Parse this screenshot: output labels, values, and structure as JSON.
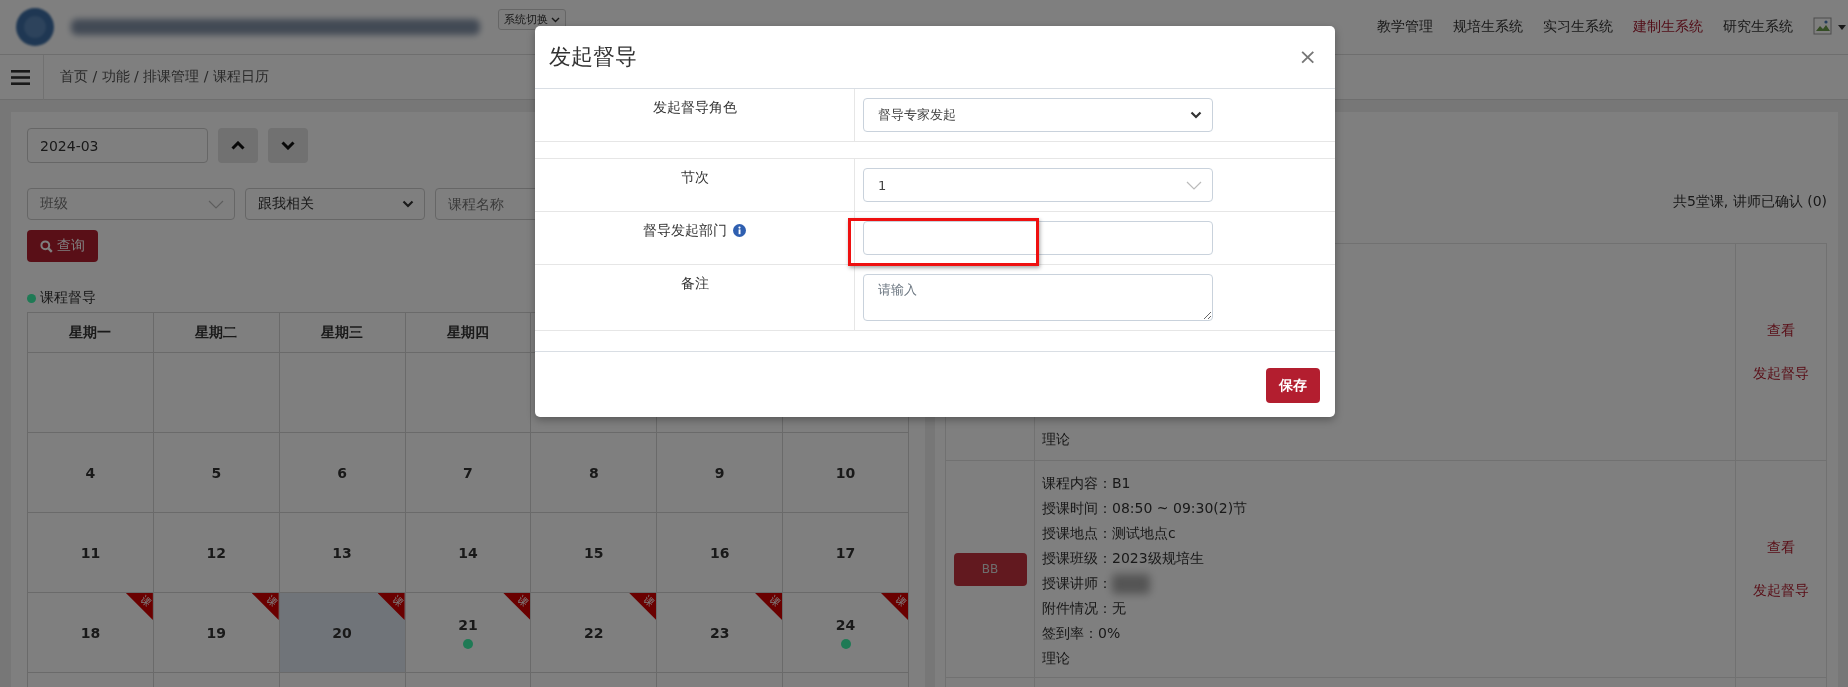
{
  "topbar": {
    "switch_label": "系统切换",
    "nav": [
      {
        "label": "教学管理",
        "selected": false
      },
      {
        "label": "规培生系统",
        "selected": false
      },
      {
        "label": "实习生系统",
        "selected": false
      },
      {
        "label": "建制生系统",
        "selected": true
      },
      {
        "label": "研究生系统",
        "selected": false
      }
    ]
  },
  "breadcrumb": "首页 / 功能 / 排课管理 / 课程日历",
  "filters": {
    "month": "2024-03",
    "class_placeholder": "班级",
    "relation": "跟我相关",
    "course_placeholder": "课程名称",
    "query_button": "查询"
  },
  "legend": {
    "label": "课程督导",
    "color": "#1f7a55"
  },
  "calendar": {
    "weekdays": [
      "星期一",
      "星期二",
      "星期三",
      "星期四"
    ],
    "weeks": [
      [
        {
          "kind": "blank"
        },
        {
          "kind": "blank"
        },
        {
          "kind": "blank"
        },
        {
          "kind": "blank"
        },
        {
          "kind": "blank"
        },
        {
          "kind": "blank"
        },
        {
          "kind": "blank"
        }
      ],
      [
        {
          "kind": "day",
          "day": "4",
          "today": false,
          "supervised": false
        },
        {
          "kind": "day",
          "day": "5",
          "today": false,
          "supervised": false
        },
        {
          "kind": "day",
          "day": "6",
          "today": false,
          "supervised": false
        },
        {
          "kind": "day",
          "day": "7",
          "today": false,
          "supervised": false
        },
        {
          "kind": "day",
          "day": "8",
          "today": false,
          "supervised": false
        },
        {
          "kind": "day",
          "day": "9",
          "today": false,
          "supervised": false
        },
        {
          "kind": "day",
          "day": "10",
          "today": false,
          "supervised": false
        }
      ],
      [
        {
          "kind": "day",
          "day": "11",
          "today": false,
          "supervised": false
        },
        {
          "kind": "day",
          "day": "12",
          "today": false,
          "supervised": false
        },
        {
          "kind": "day",
          "day": "13",
          "today": false,
          "supervised": false
        },
        {
          "kind": "day",
          "day": "14",
          "today": false,
          "supervised": false
        },
        {
          "kind": "day",
          "day": "15",
          "today": false,
          "supervised": false
        },
        {
          "kind": "day",
          "day": "16",
          "today": false,
          "supervised": false
        },
        {
          "kind": "day",
          "day": "17",
          "today": false,
          "supervised": false
        }
      ],
      [
        {
          "kind": "day",
          "day": "18",
          "today": false,
          "supervised": false,
          "corner_label": "课"
        },
        {
          "kind": "day",
          "day": "19",
          "today": false,
          "supervised": false,
          "corner_label": "课"
        },
        {
          "kind": "day",
          "day": "20",
          "today": true,
          "supervised": false,
          "corner_label": "课"
        },
        {
          "kind": "day",
          "day": "21",
          "today": false,
          "supervised": true,
          "corner_label": "课"
        },
        {
          "kind": "day",
          "day": "22",
          "today": false,
          "supervised": false,
          "corner_label": "课"
        },
        {
          "kind": "day",
          "day": "23",
          "today": false,
          "supervised": false,
          "corner_label": "课"
        },
        {
          "kind": "day",
          "day": "24",
          "today": false,
          "supervised": true,
          "corner_label": "课"
        }
      ]
    ]
  },
  "lessons": {
    "summary": "共5堂课, 讲师已确认 (0)",
    "rows": [
      {
        "lines": [
          {
            "text": "理论",
            "redacted": false
          }
        ],
        "actions": [
          "查看",
          "发起督导"
        ]
      },
      {
        "badge": "BB",
        "lines": [
          {
            "text": "课程内容：B1",
            "redacted": false
          },
          {
            "text": "授课时间：08:50 ~ 09:30(2)节",
            "redacted": false
          },
          {
            "text": "授课地点：测试地点c",
            "redacted": false
          },
          {
            "text": "授课班级：2023级规培生",
            "redacted": false
          },
          {
            "text": "授课讲师：",
            "redacted": true
          },
          {
            "text": "附件情况：无",
            "redacted": false
          },
          {
            "text": "签到率：0%",
            "redacted": false
          },
          {
            "text": "理论",
            "redacted": false
          }
        ],
        "actions": [
          "查看",
          "发起督导"
        ]
      }
    ]
  },
  "modal": {
    "title": "发起督导",
    "close": "×",
    "fields": [
      {
        "kind": "select",
        "label": "发起督导角色",
        "info": false,
        "value": "督导专家发起"
      },
      {
        "kind": "blank"
      },
      {
        "kind": "combo",
        "label": "节次",
        "info": false,
        "value": "1"
      },
      {
        "kind": "input",
        "label": "督导发起部门",
        "info": true,
        "highlighted": true
      },
      {
        "kind": "textarea",
        "label": "备注",
        "info": false,
        "placeholder": "请输入"
      }
    ],
    "save_button": "保存"
  }
}
